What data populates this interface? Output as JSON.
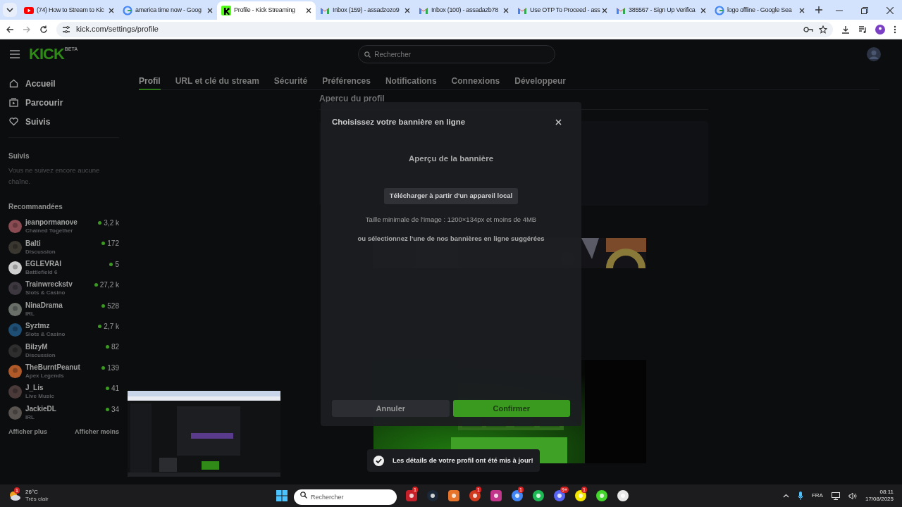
{
  "browser": {
    "tabs": [
      {
        "kind": "youtube",
        "title": "(74) How to Stream to Kic",
        "selected": false
      },
      {
        "kind": "google",
        "title": "america time now - Goog",
        "selected": false
      },
      {
        "kind": "kick",
        "title": "Profile - Kick Streaming",
        "selected": true
      },
      {
        "kind": "gmail",
        "title": "Inbox (159) - assadzozo9",
        "selected": false
      },
      {
        "kind": "gmail",
        "title": "Inbox (100) - assadazb78",
        "selected": false
      },
      {
        "kind": "gmail",
        "title": "Use OTP To Proceed - ass",
        "selected": false
      },
      {
        "kind": "gmail",
        "title": "385567 - Sign Up Verifica",
        "selected": false
      },
      {
        "kind": "google",
        "title": "logo offline - Google Sea",
        "selected": false
      }
    ],
    "address": "kick.com/settings/profile"
  },
  "header": {
    "logo": "KICK",
    "logo_badge": "BETA",
    "search_placeholder": "Rechercher"
  },
  "sidebar": {
    "nav": [
      {
        "kind": "home",
        "label": "Accueil"
      },
      {
        "kind": "browse",
        "label": "Parcourir"
      },
      {
        "kind": "heart",
        "label": "Suivis"
      }
    ],
    "followed_title": "Suivis",
    "followed_empty": "Vous ne suivez encore aucune chaîne.",
    "recommended_title": "Recommandées",
    "channels": [
      {
        "name": "jeanpormanove",
        "category": "Chained Together",
        "viewers": "3,2 k"
      },
      {
        "name": "Balti",
        "category": "Discussion",
        "viewers": "172"
      },
      {
        "name": "EGLEVRAI",
        "category": "Battlefield 6",
        "viewers": "5"
      },
      {
        "name": "Trainwreckstv",
        "category": "Slots & Casino",
        "viewers": "27,2 k"
      },
      {
        "name": "NinaDrama",
        "category": "IRL",
        "viewers": "528"
      },
      {
        "name": "Syztmz",
        "category": "Slots & Casino",
        "viewers": "2,7 k"
      },
      {
        "name": "BilzyM",
        "category": "Discussion",
        "viewers": "82"
      },
      {
        "name": "TheBurntPeanut",
        "category": "Apex Legends",
        "viewers": "139"
      },
      {
        "name": "J_Lis",
        "category": "Live Music",
        "viewers": "41"
      },
      {
        "name": "JackieDL",
        "category": "IRL",
        "viewers": "34"
      }
    ],
    "show_more": "Afficher plus",
    "show_less": "Afficher moins"
  },
  "settings": {
    "tabs": [
      {
        "label": "Profil",
        "selected": true
      },
      {
        "label": "URL et clé du stream",
        "selected": false
      },
      {
        "label": "Sécurité",
        "selected": false
      },
      {
        "label": "Préférences",
        "selected": false
      },
      {
        "label": "Notifications",
        "selected": false
      },
      {
        "label": "Connexions",
        "selected": false
      },
      {
        "label": "Développeur",
        "selected": false
      }
    ],
    "section_title": "Apercu du profil"
  },
  "modal": {
    "title": "Choisissez votre bannière en ligne",
    "preview_label": "Aperçu de la bannière",
    "upload_button": "Télécharger à partir d'un appareil local",
    "size_hint": "Taille minimale de l'image : 1200×134px et moins de 4MB",
    "suggest_hint": "ou sélectionnez l'une de nos bannières en ligne suggérées",
    "buttons": [
      {
        "kind": "secondary",
        "label": "Annuler"
      },
      {
        "kind": "primary",
        "label": "Confirmer"
      }
    ]
  },
  "toast": {
    "message": "Les détails de votre profil ont été mis à jour!"
  },
  "taskbar": {
    "weather": {
      "temperature": "26°C",
      "condition": "Très clair",
      "badge": "1"
    },
    "search_placeholder": "Rechercher",
    "apps": [
      {
        "kind": "square",
        "color": "#c4202a",
        "badge": "1"
      },
      {
        "kind": "circle",
        "color": "#1b2838"
      },
      {
        "kind": "square",
        "color": "#e8742c"
      },
      {
        "kind": "circle",
        "color": "#d03a1e",
        "badge": "1"
      },
      {
        "kind": "square",
        "color": "#c1358a"
      },
      {
        "kind": "circle",
        "color": "#4285f4",
        "badge": "1"
      },
      {
        "kind": "circle",
        "color": "#1db954"
      },
      {
        "kind": "circle",
        "color": "#5865f2",
        "badge": "9+"
      },
      {
        "kind": "circle",
        "color": "#f5e600",
        "badge": "1"
      },
      {
        "kind": "circle",
        "color": "#44d62c"
      },
      {
        "kind": "circle",
        "color": "#e8e8e8"
      }
    ],
    "language": "FRA",
    "time": "08:11",
    "date": "17/08/2025"
  }
}
